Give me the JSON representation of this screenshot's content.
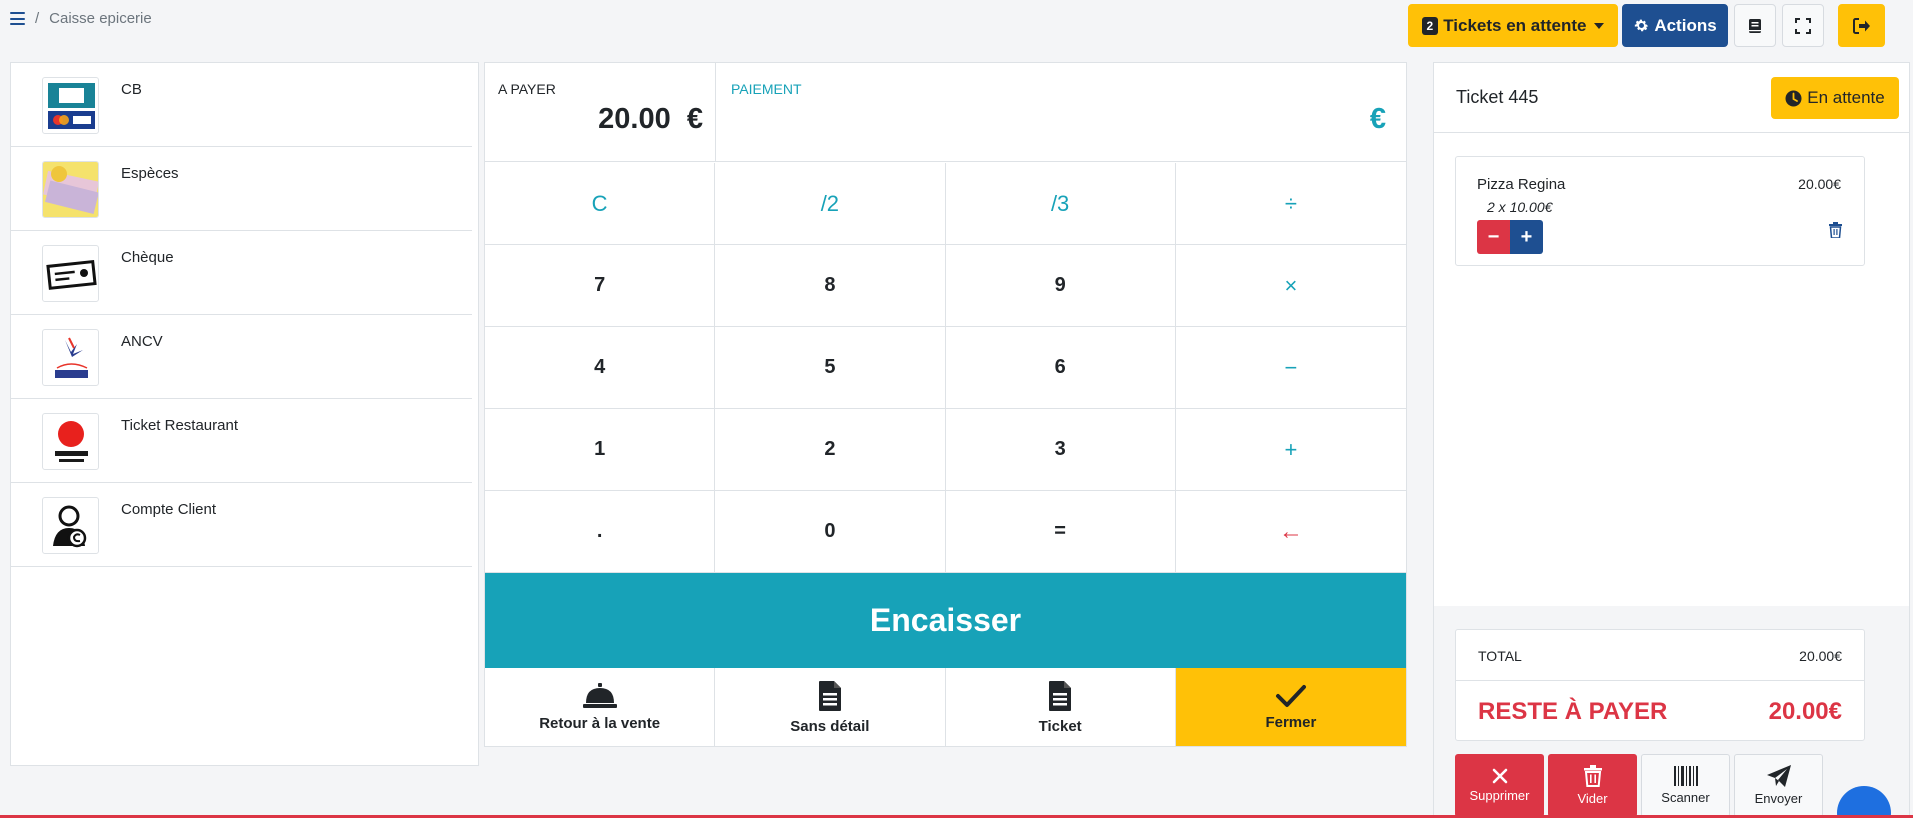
{
  "breadcrumb": {
    "separator": "/",
    "page": "Caisse epicerie"
  },
  "header": {
    "tickets_count": "2",
    "tickets_label": "Tickets en attente",
    "actions_label": "Actions"
  },
  "payment_methods": [
    {
      "label": "CB",
      "icon": "cb-card-icon"
    },
    {
      "label": "Espèces",
      "icon": "banknotes-icon"
    },
    {
      "label": "Chèque",
      "icon": "cheque-icon"
    },
    {
      "label": "ANCV",
      "icon": "ancv-logo"
    },
    {
      "label": "Ticket Restaurant",
      "icon": "ticket-restaurant-logo"
    },
    {
      "label": "Compte Client",
      "icon": "customer-account-icon"
    }
  ],
  "pad": {
    "to_pay_label": "A PAYER",
    "to_pay_value": "20.00  €",
    "payment_label": "PAIEMENT",
    "payment_value": "€",
    "keys": [
      "C",
      "/2",
      "/3",
      "÷",
      "7",
      "8",
      "9",
      "×",
      "4",
      "5",
      "6",
      "−",
      "1",
      "2",
      "3",
      "+",
      ".",
      "0",
      "=",
      "←"
    ],
    "checkout_label": "Encaisser",
    "actions": {
      "back_to_sale": "Retour à la vente",
      "no_detail": "Sans détail",
      "ticket": "Ticket",
      "close": "Fermer"
    }
  },
  "ticket": {
    "title": "Ticket 445",
    "wait_label": "En attente",
    "lines": [
      {
        "name": "Pizza Regina",
        "price": "20.00€",
        "qty": "2 x 10.00€"
      }
    ],
    "total_label": "TOTAL",
    "total_value": "20.00€",
    "rest_label": "RESTE À PAYER",
    "rest_value": "20.00€",
    "buttons": {
      "delete": "Supprimer",
      "clear": "Vider",
      "scan": "Scanner",
      "send": "Envoyer"
    }
  },
  "colors": {
    "yellow": "#ffc107",
    "blue": "#1e4f91",
    "teal": "#17a2b8",
    "red": "#dc3545"
  }
}
